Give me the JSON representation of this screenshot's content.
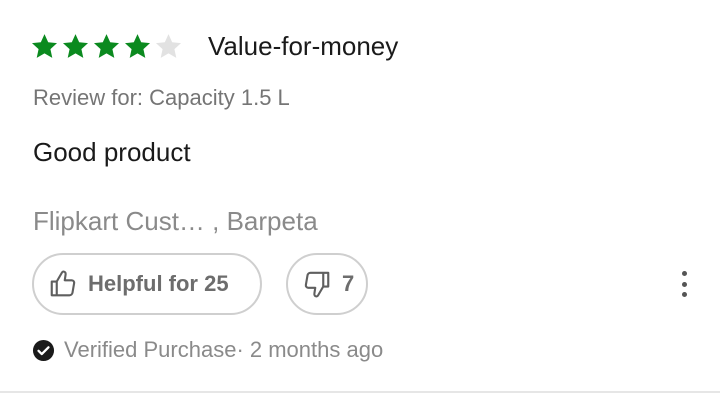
{
  "review": {
    "rating": 4,
    "max_rating": 5,
    "star_filled_color": "#0b8a1f",
    "star_empty_color": "#e2e2e2",
    "headline": "Value-for-money",
    "variant": "Review for: Capacity 1.5 L",
    "text": "Good product",
    "author": "Flipkart Cust… , Barpeta",
    "helpful_label": "Helpful for 25",
    "unhelpful_count": "7",
    "verified": "Verified Purchase",
    "time": "· 2 months ago"
  },
  "icons": {
    "star": "star-icon",
    "thumbs_up": "thumbs-up-icon",
    "thumbs_down": "thumbs-down-icon",
    "more": "more-vertical-icon",
    "verified": "check-circle-icon"
  }
}
